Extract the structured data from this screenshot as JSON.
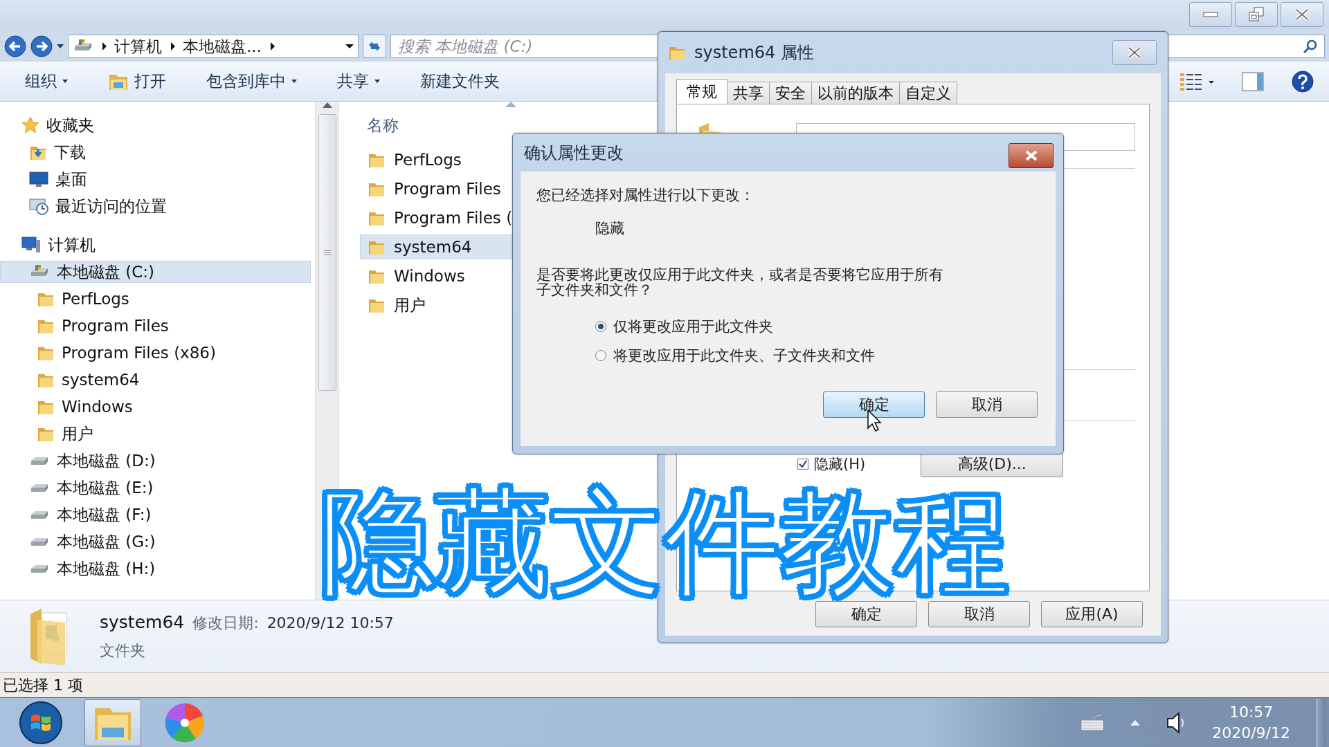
{
  "address_bar": {
    "crumbs": [
      "计算机",
      "本地磁盘..."
    ]
  },
  "search": {
    "placeholder": "搜索 本地磁盘 (C:)"
  },
  "toolbar": [
    {
      "label": "组织",
      "kind": "menu",
      "dropdown": true
    },
    {
      "label": "打开",
      "kind": "open",
      "dropdown": false
    },
    {
      "label": "包含到库中",
      "kind": "menu",
      "dropdown": true
    },
    {
      "label": "共享",
      "kind": "menu",
      "dropdown": true
    },
    {
      "label": "新建文件夹",
      "kind": "menu",
      "dropdown": false
    }
  ],
  "nav_tree": [
    {
      "label": "收藏夹",
      "kind": "star",
      "selected": false,
      "children": [
        {
          "label": "下载",
          "kind": "download",
          "selected": false
        },
        {
          "label": "桌面",
          "kind": "desktop",
          "selected": false
        },
        {
          "label": "最近访问的位置",
          "kind": "recent",
          "selected": false
        }
      ]
    },
    {
      "label": "计算机",
      "kind": "computer",
      "selected": false,
      "children": [
        {
          "label": "本地磁盘 (C:)",
          "kind": "system-drive",
          "selected": true,
          "children": [
            {
              "label": "PerfLogs",
              "kind": "folder",
              "selected": false
            },
            {
              "label": "Program Files",
              "kind": "folder",
              "selected": false
            },
            {
              "label": "Program Files (x86)",
              "kind": "folder",
              "selected": false
            },
            {
              "label": "system64",
              "kind": "folder",
              "selected": false
            },
            {
              "label": "Windows",
              "kind": "folder",
              "selected": false
            },
            {
              "label": "用户",
              "kind": "folder",
              "selected": false
            }
          ]
        },
        {
          "label": "本地磁盘 (D:)",
          "kind": "drive",
          "selected": false
        },
        {
          "label": "本地磁盘 (E:)",
          "kind": "drive",
          "selected": false
        },
        {
          "label": "本地磁盘 (F:)",
          "kind": "drive",
          "selected": false
        },
        {
          "label": "本地磁盘 (G:)",
          "kind": "drive",
          "selected": false
        },
        {
          "label": "本地磁盘 (H:)",
          "kind": "drive",
          "selected": false
        }
      ]
    }
  ],
  "file_list": {
    "column": "名称",
    "items": [
      {
        "name": "PerfLogs",
        "selected": false
      },
      {
        "name": "Program Files",
        "selected": false
      },
      {
        "name": "Program Files (",
        "selected": false
      },
      {
        "name": "system64",
        "selected": true
      },
      {
        "name": "Windows",
        "selected": false
      },
      {
        "name": "用户",
        "selected": false
      }
    ]
  },
  "details": {
    "name": "system64",
    "date_label": "修改日期:",
    "date": "2020/9/12 10:57",
    "type": "文件夹"
  },
  "status_bar": "已选择 1 项",
  "properties_dialog": {
    "title": "system64 属性",
    "tabs": [
      {
        "label": "常规",
        "selected": true
      },
      {
        "label": "共享",
        "selected": false
      },
      {
        "label": "安全",
        "selected": false
      },
      {
        "label": "以前的版本",
        "selected": false
      },
      {
        "label": "自定义",
        "selected": false
      }
    ],
    "hidden_checkbox": {
      "label": "隐藏(H)",
      "checked": true
    },
    "advanced_button": "高级(D)...",
    "buttons": [
      "确定",
      "取消",
      "应用(A)"
    ]
  },
  "confirm_dialog": {
    "title": "确认属性更改",
    "intro": "您已经选择对属性进行以下更改：",
    "change": "隐藏",
    "question": "是否要将此更改仅应用于此文件夹，或者是否要将它应用于所有子文件夹和文件？",
    "options": [
      {
        "label": "仅将更改应用于此文件夹",
        "selected": true
      },
      {
        "label": "将更改应用于此文件夹、子文件夹和文件",
        "selected": false
      }
    ],
    "buttons": [
      {
        "label": "确定",
        "focused": true
      },
      {
        "label": "取消",
        "focused": false
      }
    ]
  },
  "caption": "隐藏文件教程",
  "taskbar": {
    "time": "10:57",
    "date": "2020/9/12"
  }
}
